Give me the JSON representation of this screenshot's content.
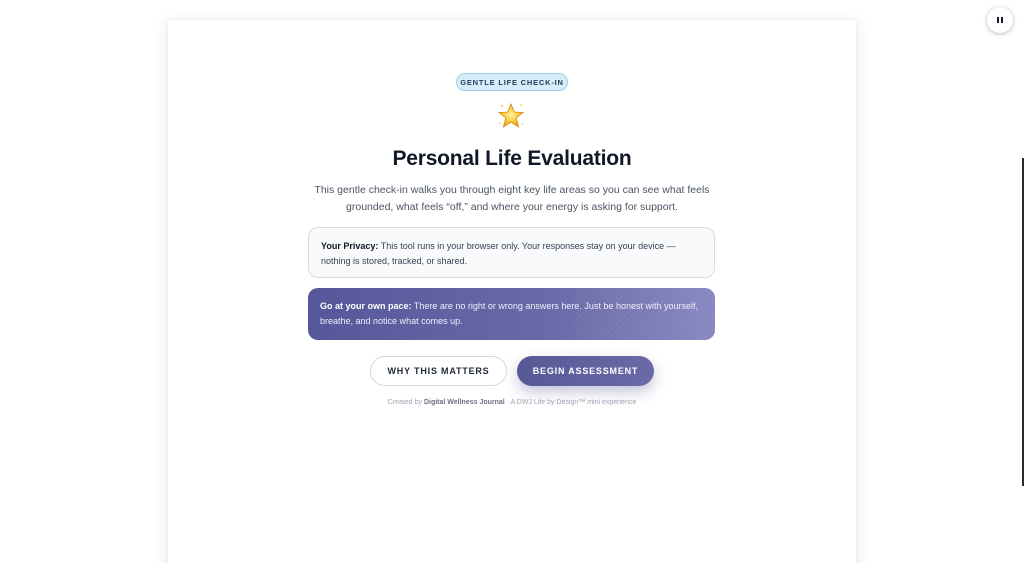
{
  "badge": "GENTLE LIFE CHECK-IN",
  "icon": "star-emoji",
  "title": "Personal Life Evaluation",
  "subtitle": "This gentle check-in walks you through eight key life areas so you can see what feels grounded, what feels “off,” and where your energy is asking for support.",
  "privacy": {
    "label": "Your Privacy:",
    "text": " This tool runs in your browser only. Your responses stay on your device — nothing is stored, tracked, or shared."
  },
  "pace": {
    "label": "Go at your own pace:",
    "text": " There are no right or wrong answers here. Just be honest with yourself, breathe, and notice what comes up."
  },
  "buttons": {
    "why": "WHY THIS MATTERS",
    "begin": "BEGIN ASSESSMENT"
  },
  "footer": {
    "prefix": "Created by ",
    "brand": "Digital Wellness Journal",
    "suffix": " · A DWJ Life by Design™ mini experience"
  },
  "colors": {
    "accent": "#565895",
    "badge_bg": "#d7eefa"
  },
  "media_control": {
    "icon": "pause-icon"
  }
}
